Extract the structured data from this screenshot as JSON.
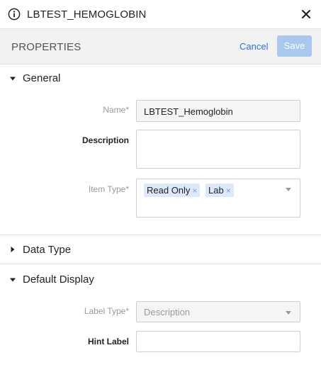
{
  "header": {
    "icon": "info-circle-icon",
    "title": "LBTEST_HEMOGLOBIN",
    "close_icon": "close-icon"
  },
  "toolbar": {
    "title": "PROPERTIES",
    "cancel_label": "Cancel",
    "save_label": "Save",
    "save_enabled": false,
    "accent_color": "#2f6fdb",
    "save_disabled_color": "#a9c8ee"
  },
  "sections": {
    "general": {
      "label": "General",
      "expanded": true,
      "name_label": "Name*",
      "name_value": "LBTEST_Hemoglobin",
      "description_label": "Description",
      "description_value": "",
      "item_type_label": "Item Type*",
      "item_type_chips": [
        "Read Only",
        "Lab"
      ],
      "chip_remove_glyph": "×"
    },
    "data_type": {
      "label": "Data Type",
      "expanded": false
    },
    "default_display": {
      "label": "Default Display",
      "expanded": true,
      "label_type_label": "Label Type*",
      "label_type_value": "Description",
      "hint_label_label": "Hint Label",
      "hint_label_value": ""
    }
  }
}
